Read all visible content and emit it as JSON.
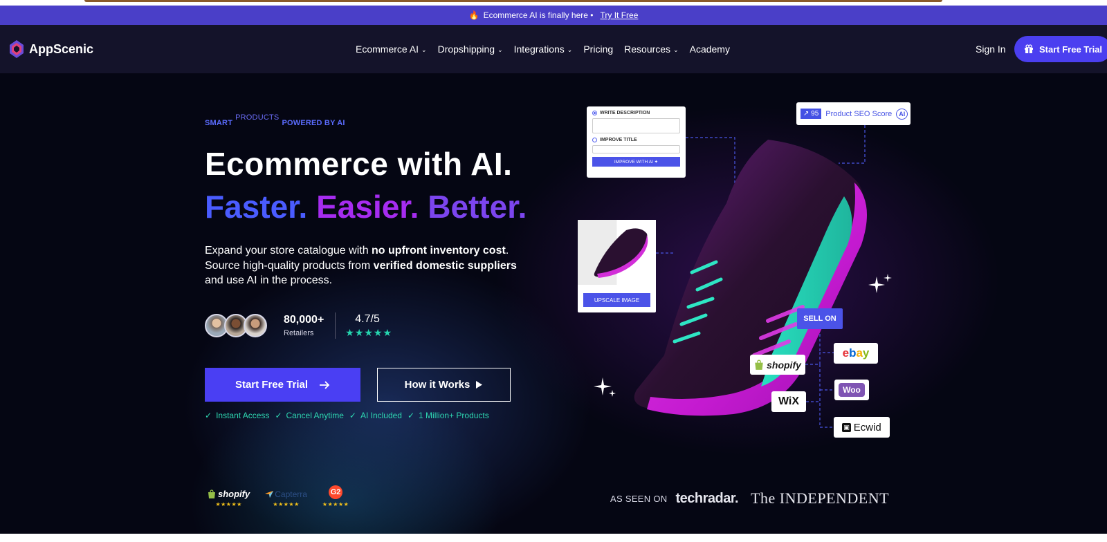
{
  "announcement": {
    "fire_icon": "fire-icon",
    "text": "Ecommerce AI is finally here •",
    "link": "Try It Free"
  },
  "nav": {
    "logo_text": "AppScenic",
    "menu": [
      {
        "label": "Ecommerce AI",
        "dropdown": true
      },
      {
        "label": "Dropshipping",
        "dropdown": true
      },
      {
        "label": "Integrations",
        "dropdown": true
      },
      {
        "label": "Pricing",
        "dropdown": false
      },
      {
        "label": "Resources",
        "dropdown": true
      },
      {
        "label": "Academy",
        "dropdown": false
      }
    ],
    "sign_in": "Sign In",
    "cta": "Start Free Trial"
  },
  "hero": {
    "eyebrow_left": "SMART",
    "eyebrow_mid": "PRODUCTS",
    "eyebrow_right": "POWERED BY AI",
    "title": "Ecommerce with AI.",
    "tagline_1": "Faster.",
    "tagline_2": "Easier.",
    "tagline_3": "Better.",
    "desc_1": "Expand your store catalogue with ",
    "desc_b1": "no upfront inventory cost",
    "desc_2": ". Source high-quality products from ",
    "desc_b2": "verified domestic suppliers",
    "desc_3": " and use AI in the process.",
    "retailers_count": "80,000+",
    "retailers_label": "Retailers",
    "rating": "4.7/5",
    "rating_stars": 5,
    "btn_primary": "Start Free Trial",
    "btn_secondary": "How it Works",
    "checks": [
      "Instant Access",
      "Cancel Anytime",
      "AI Included",
      "1 Million+ Products"
    ]
  },
  "trust": {
    "badges": [
      "shopify",
      "Capterra",
      "G2"
    ],
    "as_seen_on": "AS SEEN ON",
    "press": [
      "techradar.",
      "The INDEPENDENT"
    ]
  },
  "illustration": {
    "write_description": "WRITE DESCRIPTION",
    "improve_title": "IMPROVE TITLE",
    "improve_btn": "IMPROVE WITH AI",
    "seo_score": "95",
    "seo_label": "Product SEO Score",
    "upscale": "UPSCALE IMAGE",
    "sell_on": "SELL ON",
    "platforms": [
      "shopify",
      "ebay",
      "WiX",
      "Woo",
      "Ecwid"
    ]
  },
  "colors": {
    "accent": "#4a3ff3",
    "announce_bg": "#4a3fc8",
    "nav_bg": "#14132a",
    "teal": "#26d6b0",
    "purple": "#a62cf0"
  }
}
